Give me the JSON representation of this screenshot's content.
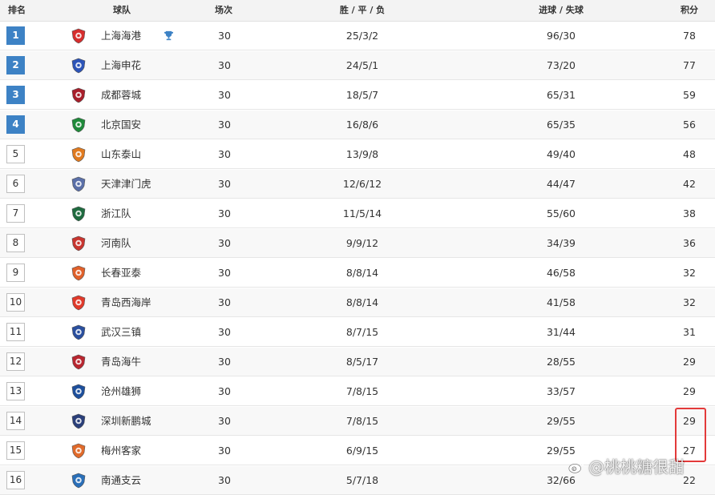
{
  "headers": {
    "rank": "排名",
    "team": "球队",
    "played": "场次",
    "wdl": "胜 / 平 / 负",
    "goals": "进球 / 失球",
    "points": "积分"
  },
  "colors": {
    "top_rank_bg": "#3d82c5",
    "highlight_border": "#e33a3a"
  },
  "rows": [
    {
      "rank": "1",
      "team": "上海海港",
      "played": "30",
      "wdl": "25/3/2",
      "goals": "96/30",
      "points": "78",
      "logo": "shanghai-port-crest-icon",
      "logo_color": "#d62d2d",
      "trophy_icon": "trophy-icon"
    },
    {
      "rank": "2",
      "team": "上海申花",
      "played": "30",
      "wdl": "24/5/1",
      "goals": "73/20",
      "points": "77",
      "logo": "shanghai-shenhua-crest-icon",
      "logo_color": "#2c54b8"
    },
    {
      "rank": "3",
      "team": "成都蓉城",
      "played": "30",
      "wdl": "18/5/7",
      "goals": "65/31",
      "points": "59",
      "logo": "chengdu-rongcheng-crest-icon",
      "logo_color": "#a81e2a"
    },
    {
      "rank": "4",
      "team": "北京国安",
      "played": "30",
      "wdl": "16/8/6",
      "goals": "65/35",
      "points": "56",
      "logo": "beijing-guoan-crest-icon",
      "logo_color": "#1f8a3a"
    },
    {
      "rank": "5",
      "team": "山东泰山",
      "played": "30",
      "wdl": "13/9/8",
      "goals": "49/40",
      "points": "48",
      "logo": "shandong-taishan-crest-icon",
      "logo_color": "#e07a1f"
    },
    {
      "rank": "6",
      "team": "天津津门虎",
      "played": "30",
      "wdl": "12/6/12",
      "goals": "44/47",
      "points": "42",
      "logo": "tianjin-jinmen-tiger-crest-icon",
      "logo_color": "#5a6fa8"
    },
    {
      "rank": "7",
      "team": "浙江队",
      "played": "30",
      "wdl": "11/5/14",
      "goals": "55/60",
      "points": "38",
      "logo": "zhejiang-crest-icon",
      "logo_color": "#1f6b3f"
    },
    {
      "rank": "8",
      "team": "河南队",
      "played": "30",
      "wdl": "9/9/12",
      "goals": "34/39",
      "points": "36",
      "logo": "henan-crest-icon",
      "logo_color": "#c8352f"
    },
    {
      "rank": "9",
      "team": "长春亚泰",
      "played": "30",
      "wdl": "8/8/14",
      "goals": "46/58",
      "points": "32",
      "logo": "changchun-yatai-crest-icon",
      "logo_color": "#e0602a"
    },
    {
      "rank": "10",
      "team": "青岛西海岸",
      "played": "30",
      "wdl": "8/8/14",
      "goals": "41/58",
      "points": "32",
      "logo": "qingdao-west-coast-crest-icon",
      "logo_color": "#e0392a"
    },
    {
      "rank": "11",
      "team": "武汉三镇",
      "played": "30",
      "wdl": "8/7/15",
      "goals": "31/44",
      "points": "31",
      "logo": "wuhan-three-towns-crest-icon",
      "logo_color": "#2a4f9e"
    },
    {
      "rank": "12",
      "team": "青岛海牛",
      "played": "30",
      "wdl": "8/5/17",
      "goals": "28/55",
      "points": "29",
      "logo": "qingdao-hainiu-crest-icon",
      "logo_color": "#b8262f"
    },
    {
      "rank": "13",
      "team": "沧州雄狮",
      "played": "30",
      "wdl": "7/8/15",
      "goals": "33/57",
      "points": "29",
      "logo": "cangzhou-lions-crest-icon",
      "logo_color": "#1d4f9c"
    },
    {
      "rank": "14",
      "team": "深圳新鹏城",
      "played": "30",
      "wdl": "7/8/15",
      "goals": "29/55",
      "points": "29",
      "logo": "shenzhen-peng-city-crest-icon",
      "logo_color": "#2a3f7a"
    },
    {
      "rank": "15",
      "team": "梅州客家",
      "played": "30",
      "wdl": "6/9/15",
      "goals": "29/55",
      "points": "27",
      "logo": "meizhou-hakka-crest-icon",
      "logo_color": "#e06a2a"
    },
    {
      "rank": "16",
      "team": "南通支云",
      "played": "30",
      "wdl": "5/7/18",
      "goals": "32/66",
      "points": "22",
      "logo": "nantong-zhiyun-crest-icon",
      "logo_color": "#2a6fb8"
    }
  ],
  "watermark": {
    "text": "@桃桃糖很甜",
    "icon": "weibo-icon"
  }
}
